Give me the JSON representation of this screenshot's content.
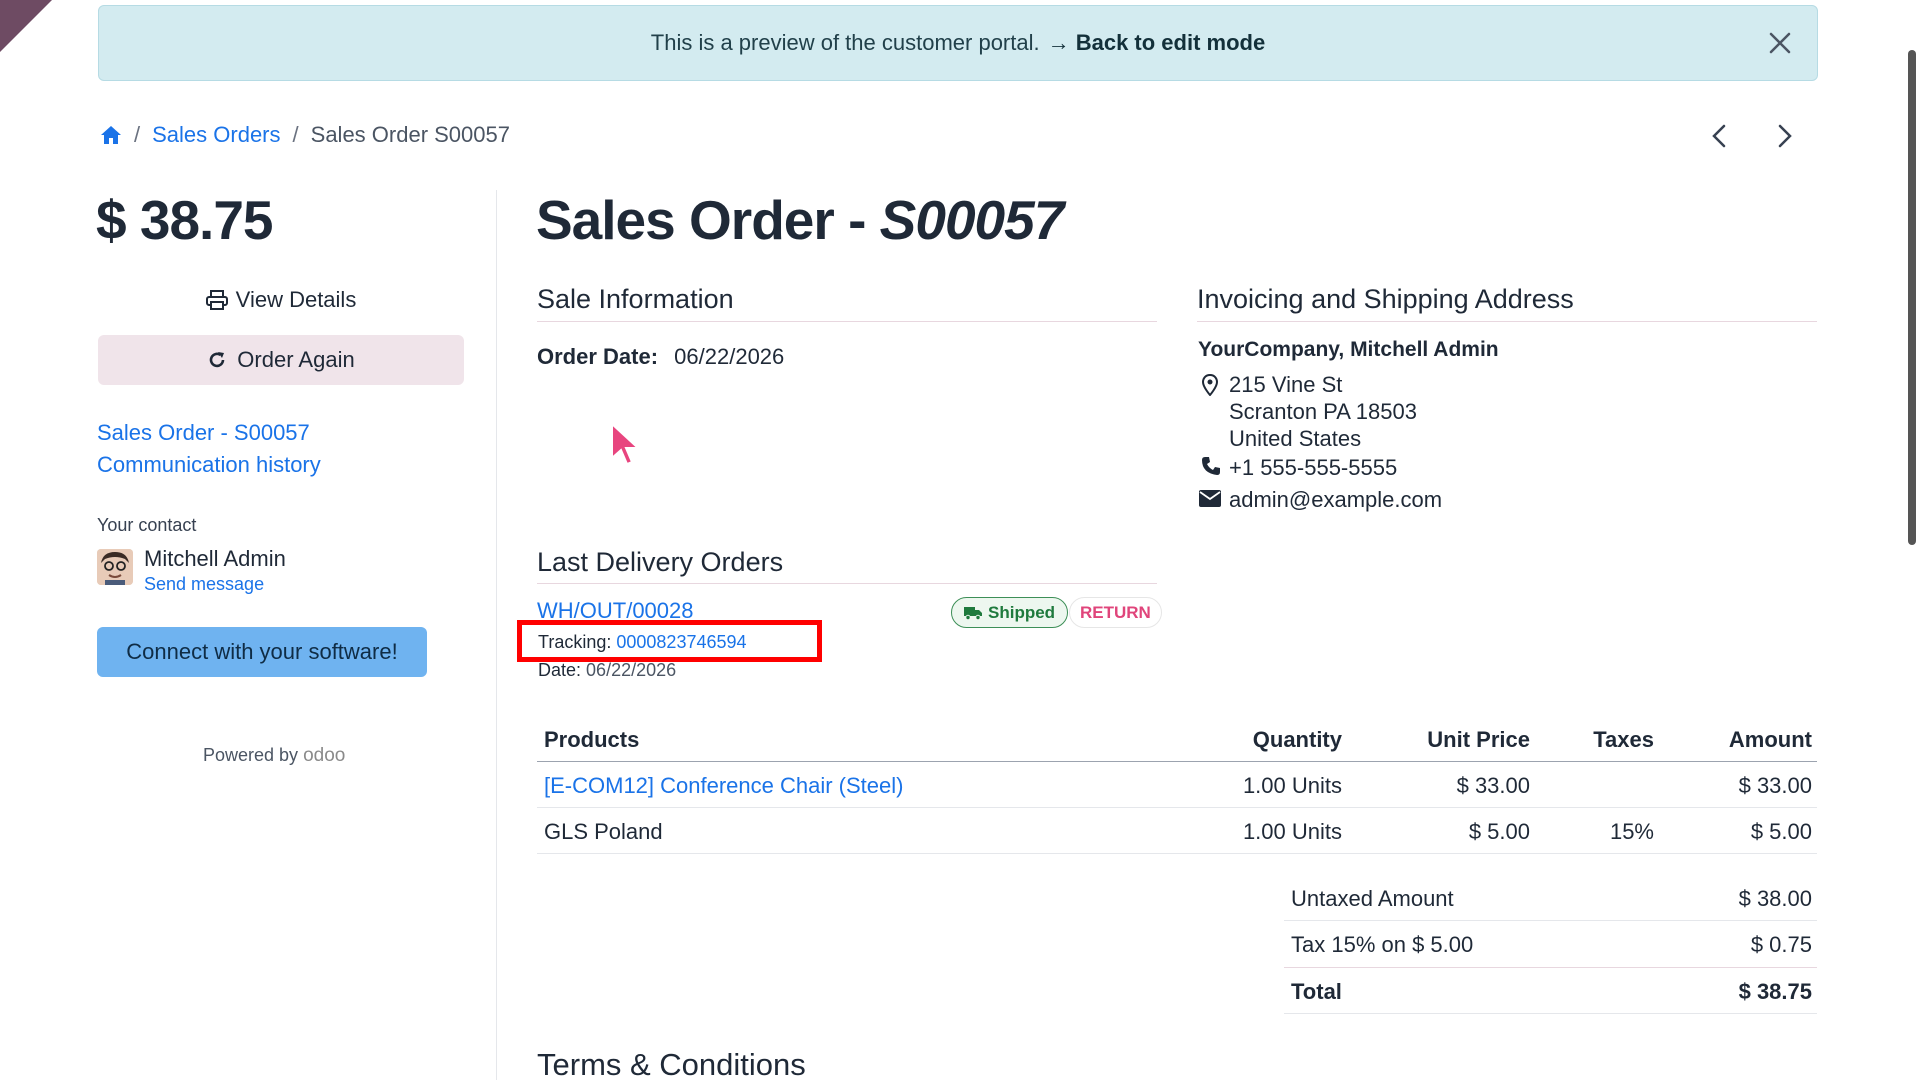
{
  "banner": {
    "text": "This is a preview of the customer portal.",
    "link_label": "→ Back to edit mode"
  },
  "breadcrumb": {
    "home_icon": "home-icon",
    "sales_orders": "Sales Orders",
    "current": "Sales Order S00057",
    "separator": "/"
  },
  "sidebar": {
    "price": "$ 38.75",
    "view_details": "View Details",
    "order_again": "Order Again",
    "links": [
      "Sales Order - S00057",
      "Communication history"
    ],
    "contact_label": "Your contact",
    "contact_name": "Mitchell Admin",
    "send_message": "Send message",
    "connect_button": "Connect with your software!",
    "powered_by": "Powered by",
    "powered_brand": "odoo"
  },
  "main": {
    "title_prefix": "Sales Order - ",
    "title_ref": "S00057",
    "sale_info": {
      "heading": "Sale Information",
      "order_date_label": "Order Date:",
      "order_date": "06/22/2026"
    },
    "address": {
      "heading": "Invoicing and Shipping Address",
      "name": "YourCompany, Mitchell Admin",
      "street": "215 Vine St",
      "city": "Scranton PA 18503",
      "country": "United States",
      "phone": "+1 555-555-5555",
      "email": "admin@example.com"
    },
    "delivery": {
      "heading": "Last Delivery Orders",
      "ref": "WH/OUT/00028",
      "status": "Shipped",
      "return_label": "RETURN",
      "tracking_label": "Tracking:",
      "tracking_number": "0000823746594",
      "date_label": "Date:",
      "date": "06/22/2026"
    },
    "table": {
      "headers": [
        "Products",
        "Quantity",
        "Unit Price",
        "Taxes",
        "Amount"
      ],
      "rows": [
        {
          "product": "[E-COM12] Conference Chair (Steel)",
          "quantity": "1.00 Units",
          "unit_price": "$ 33.00",
          "taxes": "",
          "amount": "$ 33.00"
        },
        {
          "product": "GLS Poland",
          "quantity": "1.00 Units",
          "unit_price": "$ 5.00",
          "taxes": "15%",
          "amount": "$ 5.00"
        }
      ]
    },
    "totals": {
      "untaxed_label": "Untaxed Amount",
      "untaxed": "$ 38.00",
      "tax_label": "Tax 15% on $ 5.00",
      "tax": "$ 0.75",
      "total_label": "Total",
      "total": "$ 38.75"
    },
    "terms_heading": "Terms & Conditions"
  },
  "colors": {
    "link": "#1a73e8",
    "banner_bg": "#d3ebf0",
    "order_again_bg": "#f0e4ea",
    "connect_bg": "#6fb3f0",
    "shipped": "#1f7a3d",
    "return": "#e0457b",
    "highlight": "#ff0000"
  }
}
